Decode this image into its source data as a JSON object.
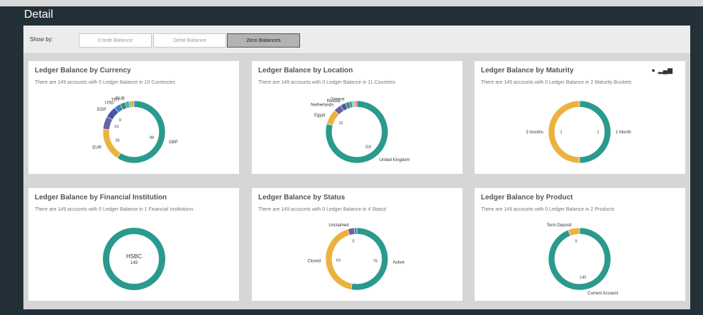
{
  "header": {
    "title": "Detail"
  },
  "toolbar": {
    "show_by_label": "Show by:",
    "toggles": [
      "Credit Balance",
      "Debit Balance",
      "Zero Balances"
    ],
    "active_index": 2
  },
  "colors": {
    "teal": "#2a9a8e",
    "gold": "#ecb23e",
    "purple": "#6a60a6",
    "blue": "#3a82c4",
    "green": "#3d8f57",
    "lime": "#9ac24a",
    "pink": "#d6648a",
    "orange": "#e2722f"
  },
  "cards": [
    {
      "title": "Ledger Balance by Currency",
      "subtitle": "There are 149 accounts with 0 Ledger Balance in 10 Currencies"
    },
    {
      "title": "Ledger Balance by Location",
      "subtitle": "There are 149 accounts with 0 Ledger Balance in 11 Countries"
    },
    {
      "title": "Ledger Balance by Maturity",
      "subtitle": "There are 149 accounts with 0 Ledger Balance in 2 Maturity Buckets",
      "icons": [
        "pie-icon",
        "bar-chart-icon"
      ]
    },
    {
      "title": "Ledger Balance by Financial Institution",
      "subtitle": "There are 149 accounts with 0 Ledger Balance in 1 Financial Institutions"
    },
    {
      "title": "Ledger Balance by Status",
      "subtitle": "There are 149 accounts with 0 Ledger Balance in 4 Status'"
    },
    {
      "title": "Ledger Balance by Product",
      "subtitle": "There are 149 accounts with 0 Ledger Balance in 2 Products"
    }
  ],
  "chart_data": [
    {
      "type": "pie",
      "variant": "donut",
      "total": 149,
      "slices": [
        {
          "label": "GBP",
          "value": 88,
          "color": "#2a9a8e",
          "value_label": "88"
        },
        {
          "label": "EUR",
          "value": 26,
          "color": "#ecb23e",
          "value_label": "26"
        },
        {
          "label": "",
          "value": 10,
          "color": "#6a60a6",
          "value_label": "10"
        },
        {
          "label": "EGP",
          "value": 9,
          "color": "#4a56a0",
          "value_label": "9"
        },
        {
          "label": "USD",
          "value": 5,
          "color": "#3a82c4",
          "value_label": ""
        },
        {
          "label": "TRY",
          "value": 4,
          "color": "#3d8f57",
          "value_label": ""
        },
        {
          "label": "RUB",
          "value": 3,
          "color": "#2fb1d8",
          "value_label": ""
        },
        {
          "label": "",
          "value": 2,
          "color": "#9ac24a",
          "value_label": ""
        },
        {
          "label": "",
          "value": 1,
          "color": "#e2722f",
          "value_label": ""
        },
        {
          "label": "",
          "value": 1,
          "color": "#d6648a",
          "value_label": ""
        }
      ]
    },
    {
      "type": "pie",
      "variant": "donut",
      "total": 149,
      "slices": [
        {
          "label": "United Kingdom",
          "value": 118,
          "color": "#2a9a8e",
          "value_label": "118"
        },
        {
          "label": "Egypt",
          "value": 12,
          "color": "#ecb23e",
          "value_label": "12"
        },
        {
          "label": "Netherlands",
          "value": 6,
          "color": "#6a60a6",
          "value_label": ""
        },
        {
          "label": "Russia",
          "value": 4,
          "color": "#4a56a0",
          "value_label": ""
        },
        {
          "label": "Greece",
          "value": 3,
          "color": "#3d8f57",
          "value_label": ""
        },
        {
          "label": "",
          "value": 2,
          "color": "#3a82c4",
          "value_label": ""
        },
        {
          "label": "",
          "value": 1,
          "color": "#2fb1d8",
          "value_label": ""
        },
        {
          "label": "",
          "value": 1,
          "color": "#9ac24a",
          "value_label": ""
        },
        {
          "label": "",
          "value": 1,
          "color": "#e2722f",
          "value_label": ""
        },
        {
          "label": "",
          "value": 1,
          "color": "#d6648a",
          "value_label": ""
        }
      ]
    },
    {
      "type": "pie",
      "variant": "donut",
      "total": 2,
      "slices": [
        {
          "label": "1 Month",
          "value": 1,
          "color": "#2a9a8e",
          "value_label": "1"
        },
        {
          "label": "3 months",
          "value": 1,
          "color": "#ecb23e",
          "value_label": "1"
        }
      ]
    },
    {
      "type": "pie",
      "variant": "donut",
      "total": 149,
      "center_text": "HSBC",
      "center_value": "149",
      "slices": [
        {
          "label": "HSBC",
          "value": 149,
          "color": "#2a9a8e",
          "value_label": ""
        }
      ]
    },
    {
      "type": "pie",
      "variant": "donut",
      "total": 149,
      "slices": [
        {
          "label": "Active",
          "value": 79,
          "color": "#2a9a8e",
          "value_label": "79"
        },
        {
          "label": "Closed",
          "value": 63,
          "color": "#ecb23e",
          "value_label": "63"
        },
        {
          "label": "Unclaimed",
          "value": 5,
          "color": "#6a60a6",
          "value_label": "5"
        },
        {
          "label": "",
          "value": 2,
          "color": "#3a82c4",
          "value_label": ""
        }
      ]
    },
    {
      "type": "pie",
      "variant": "donut",
      "total": 149,
      "slices": [
        {
          "label": "Current Account",
          "value": 140,
          "color": "#2a9a8e",
          "value_label": "140"
        },
        {
          "label": "Term Deposit",
          "value": 9,
          "color": "#ecb23e",
          "value_label": "9"
        }
      ]
    }
  ]
}
